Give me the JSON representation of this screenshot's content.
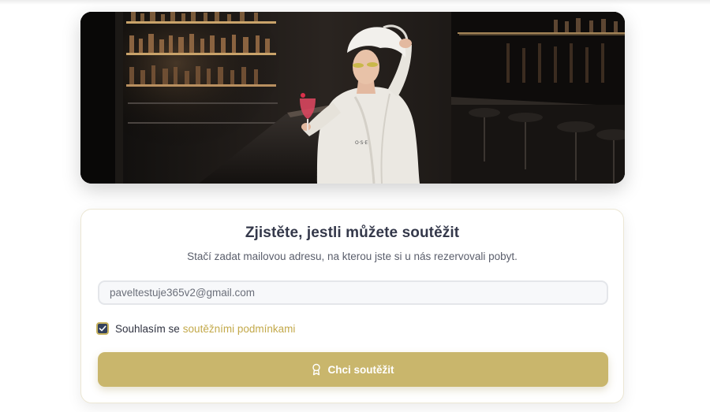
{
  "hero": {
    "image_subject": "woman in white bathrobe and head towel with eye patches holding a pink cocktail at a dark hotel bar"
  },
  "form": {
    "title": "Zjistěte, jestli můžete soutěžit",
    "subtitle": "Stačí zadat mailovou adresu, na kterou jste si u nás rezervovali pobyt.",
    "email_value": "paveltestuje365v2@gmail.com",
    "email_placeholder": "",
    "consent_checked": true,
    "consent_prefix": "Souhlasím se",
    "consent_link": "soutěžními podmínkami",
    "submit_label": "Chci soutěžit",
    "submit_icon": "award-ribbon-icon"
  },
  "colors": {
    "accent_gold": "#c9b66c",
    "link_gold": "#c3a94a",
    "title_text": "#34384a",
    "checkbox_fill": "#33415c"
  }
}
